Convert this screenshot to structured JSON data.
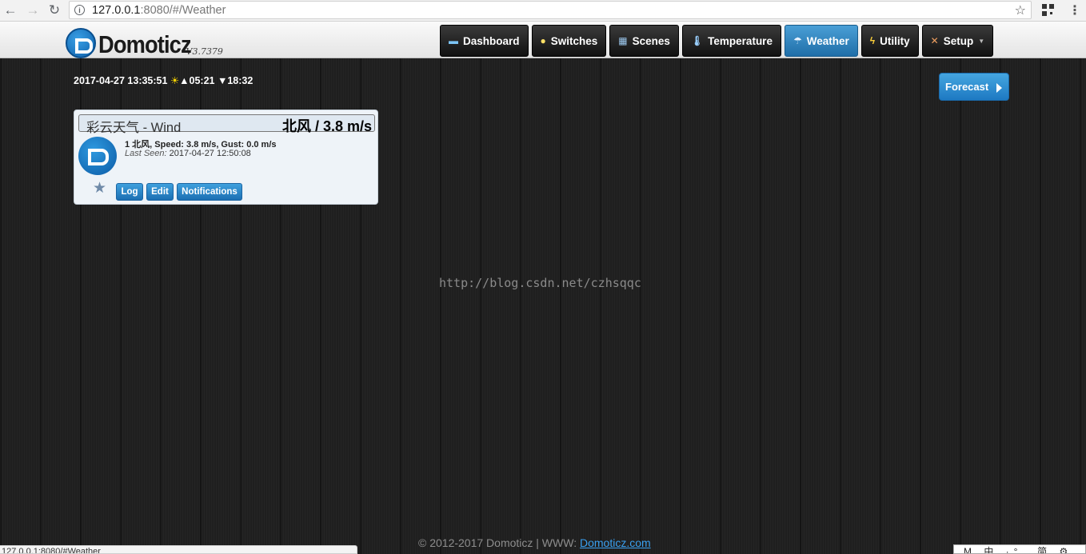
{
  "browser": {
    "url_host": "127.0.0.1",
    "url_rest": ":8080/#/Weather",
    "status_url": "127.0.0.1:8080/#Weather"
  },
  "header": {
    "logo_text": "Domoticz",
    "version": "V3.7379",
    "tabs": [
      {
        "label": "Dashboard",
        "icon": "monitor-icon"
      },
      {
        "label": "Switches",
        "icon": "lightbulb-icon"
      },
      {
        "label": "Scenes",
        "icon": "clapperboard-icon"
      },
      {
        "label": "Temperature",
        "icon": "thermometer-icon"
      },
      {
        "label": "Weather",
        "icon": "cloud-rain-icon",
        "active": true
      },
      {
        "label": "Utility",
        "icon": "lightning-icon"
      },
      {
        "label": "Setup",
        "icon": "tools-icon"
      }
    ]
  },
  "status": {
    "datetime": "2017-04-27 13:35:51",
    "sunrise": "▲05:21",
    "sunset": "▼18:32"
  },
  "forecast_label": "Forecast",
  "device": {
    "name": "彩云天气 - Wind",
    "value": "北风 / 3.8 m/s",
    "data": "1 北风, Speed: 3.8 m/s, Gust: 0.0 m/s",
    "last_seen_label": "Last Seen:",
    "last_seen": "2017-04-27 12:50:08",
    "buttons": {
      "log": "Log",
      "edit": "Edit",
      "notifications": "Notifications"
    }
  },
  "watermark": "http://blog.csdn.net/czhsqqc",
  "footer": {
    "text": "© 2012-2017 Domoticz | WWW:",
    "link": "Domoticz.com"
  },
  "ime": "M 中 ·°, 简 ⚙ ·"
}
